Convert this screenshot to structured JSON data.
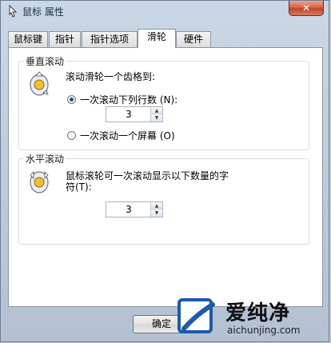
{
  "window": {
    "title": "鼠标 属性",
    "close_label": "✕"
  },
  "tabs": [
    {
      "label": "鼠标键",
      "active": false
    },
    {
      "label": "指针",
      "active": false
    },
    {
      "label": "指针选项",
      "active": false
    },
    {
      "label": "滑轮",
      "active": true
    },
    {
      "label": "硬件",
      "active": false
    }
  ],
  "vertical_scroll": {
    "group_title": "垂直滚动",
    "description": "滚动滑轮一个齿格到:",
    "option_lines": {
      "label": "一次滚动下列行数 (N):",
      "checked": true
    },
    "lines_value": "3",
    "option_screen": {
      "label": "一次滚动一个屏幕 (O)",
      "checked": false
    }
  },
  "horizontal_scroll": {
    "group_title": "水平滚动",
    "description_line1": "鼠标滚轮可一次滚动显示以下数量的字",
    "description_line2": "符(T):",
    "chars_value": "3"
  },
  "buttons": {
    "ok": "确定"
  },
  "watermark": {
    "title": "爱纯净",
    "url": "aichunjing.com"
  },
  "colors": {
    "accent": "#1d5aa8",
    "close": "#c1452b"
  }
}
